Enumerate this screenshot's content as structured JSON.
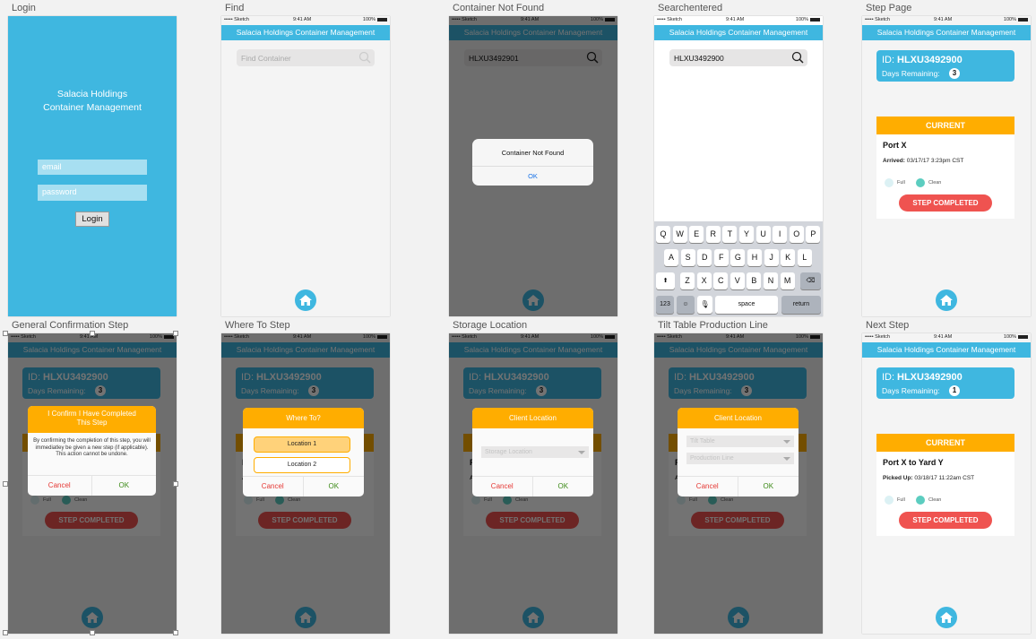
{
  "screens": [
    "Login",
    "Find",
    "Container Not Found",
    "Searchentered",
    "Step Page",
    "General Confirmation Step",
    "Where To Step",
    "Storage Location",
    "Tilt Table Production Line",
    "Next Step"
  ],
  "app": {
    "title": "Salacia Holdings Container Management",
    "status": {
      "carrier": "••••• Sketch",
      "time": "9:41 AM",
      "battery": "100%"
    },
    "colors": {
      "brand": "#3fb7e0",
      "accent": "#ffad00",
      "danger": "#ef5350",
      "clean": "#5ccdc0",
      "full": "#dcf1f4"
    }
  },
  "login": {
    "title_line1": "Salacia Holdings",
    "title_line2": "Container Management",
    "email_placeholder": "email",
    "password_placeholder": "password",
    "button": "Login"
  },
  "find": {
    "placeholder": "Find Container"
  },
  "not_found": {
    "query": "HLXU3492901",
    "alert_title": "Container Not Found",
    "ok": "OK"
  },
  "search_entered": {
    "query": "HLXU3492900",
    "keyboard": {
      "rows": [
        [
          "Q",
          "W",
          "E",
          "R",
          "T",
          "Y",
          "U",
          "I",
          "O",
          "P"
        ],
        [
          "A",
          "S",
          "D",
          "F",
          "G",
          "H",
          "J",
          "K",
          "L"
        ],
        [
          "Z",
          "X",
          "C",
          "V",
          "B",
          "N",
          "M"
        ]
      ],
      "numbers": "123",
      "space": "space",
      "return": "return"
    }
  },
  "step": {
    "id_prefix": "ID:",
    "id": "HLXU3492900",
    "days_label": "Days Remaining:",
    "days": "3",
    "current": "CURRENT",
    "location": "Port X",
    "date_label": "Arrived:",
    "date": "03/17/17 3:23pm CST",
    "full": "Full",
    "clean": "Clean",
    "button": "STEP COMPLETED"
  },
  "next_step": {
    "id_prefix": "ID:",
    "id": "HLXU3492900",
    "days_label": "Days Remaining:",
    "days": "1",
    "current": "CURRENT",
    "location": "Port X to Yard Y",
    "date_label": "Picked Up:",
    "date": "03/18/17 11:22am CST",
    "full": "Full",
    "clean": "Clean",
    "button": "STEP COMPLETED"
  },
  "confirm": {
    "title": "I Confirm I Have Completed This Step",
    "body": "By confirming the completion of this step, you will immediatley be given a new step (if applicable). This action cannot be undone.",
    "cancel": "Cancel",
    "ok": "OK"
  },
  "where_to": {
    "title": "Where To?",
    "options": [
      "Location 1",
      "Location 2"
    ],
    "cancel": "Cancel",
    "ok": "OK"
  },
  "storage": {
    "title": "Client Location",
    "select": "Storage Location",
    "cancel": "Cancel",
    "ok": "OK"
  },
  "tilt": {
    "title": "Client Location",
    "select1": "Tilt Table",
    "select2": "Production Line",
    "cancel": "Cancel",
    "ok": "OK"
  }
}
